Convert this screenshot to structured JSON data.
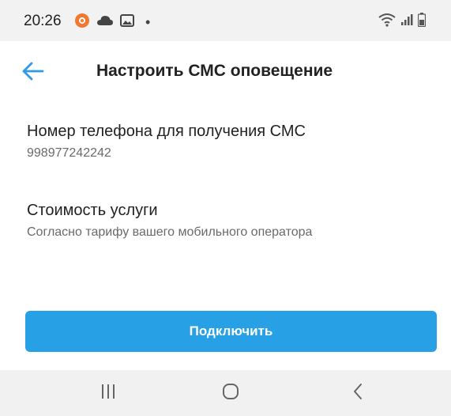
{
  "status_bar": {
    "time": "20:26",
    "dot": "•",
    "icons_left": [
      "notification-app-icon",
      "cloud-icon",
      "image-icon"
    ],
    "icons_right": [
      "wifi-icon",
      "signal-icon",
      "battery-icon"
    ]
  },
  "header": {
    "back_icon": "arrow-left-icon",
    "title": "Настроить СМС оповещение"
  },
  "phone_section": {
    "title": "Номер телефона для получения СМС",
    "value": "998977242242"
  },
  "cost_section": {
    "title": "Стоимость услуги",
    "value": "Согласно тарифу вашего мобильного оператора"
  },
  "action": {
    "connect_label": "Подключить"
  },
  "nav_bar": {
    "recents_icon": "recents-icon",
    "home_icon": "home-icon",
    "back_icon": "back-chevron-icon"
  },
  "colors": {
    "accent": "#27a0e6",
    "status_bar_bg": "#f2f2f2",
    "nav_bar_bg": "#f1f1f1",
    "title_text": "#222222",
    "secondary_text": "#6a6a6a",
    "notification_icon": "#f2782f"
  }
}
